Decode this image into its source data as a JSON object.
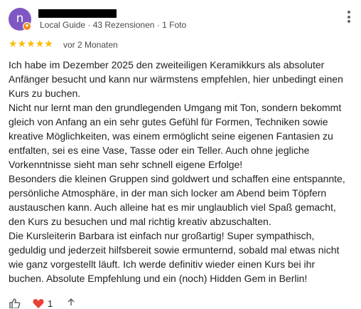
{
  "review": {
    "avatar_initial": "n",
    "badge_icon": "star-badge-icon",
    "meta": "Local Guide · 43 Rezensionen · 1 Foto",
    "stars": "★★★★★",
    "rating": 5,
    "time": "vor 2 Monaten",
    "paragraphs": [
      "Ich habe im Dezember 2025 den zweiteiligen Keramikkurs als absoluter Anfänger besucht und kann nur wärmstens empfehlen, hier unbedingt einen Kurs zu buchen.",
      "Nicht nur lernt man den grundlegenden Umgang mit Ton, sondern bekommt gleich von Anfang an ein sehr gutes Gefühl für Formen, Techniken sowie kreative Möglichkeiten, was einem ermöglicht seine eigenen Fantasien zu entfalten, sei es eine Vase, Tasse oder ein Teller. Auch ohne jegliche Vorkenntnisse sieht man sehr schnell eigene Erfolge!",
      "Besonders die kleinen Gruppen sind goldwert und schaffen eine entspannte, persönliche Atmosphäre, in der man sich locker am Abend beim Töpfern austauschen kann. Auch alleine hat es mir unglaublich viel Spaß gemacht, den Kurs zu besuchen und mal richtig kreativ abzuschalten.",
      "Die Kursleiterin Barbara ist einfach nur großartig! Super sympathisch, geduldig und jederzeit hilfsbereit sowie ermunternd, sobald mal etwas nicht wie ganz vorgestellt läuft. Ich werde definitiv wieder einen Kurs bei ihr buchen. Absolute Empfehlung und ein (noch) Hidden Gem in Berlin!"
    ]
  },
  "colors": {
    "avatar": "#7e57c2",
    "badge": "#f28b1c",
    "stars": "#fbbc04",
    "heart": "#ea4335"
  },
  "actions": {
    "reaction_count": "1",
    "icons": [
      "thumbs-up-icon",
      "heart-icon",
      "share-icon"
    ]
  }
}
